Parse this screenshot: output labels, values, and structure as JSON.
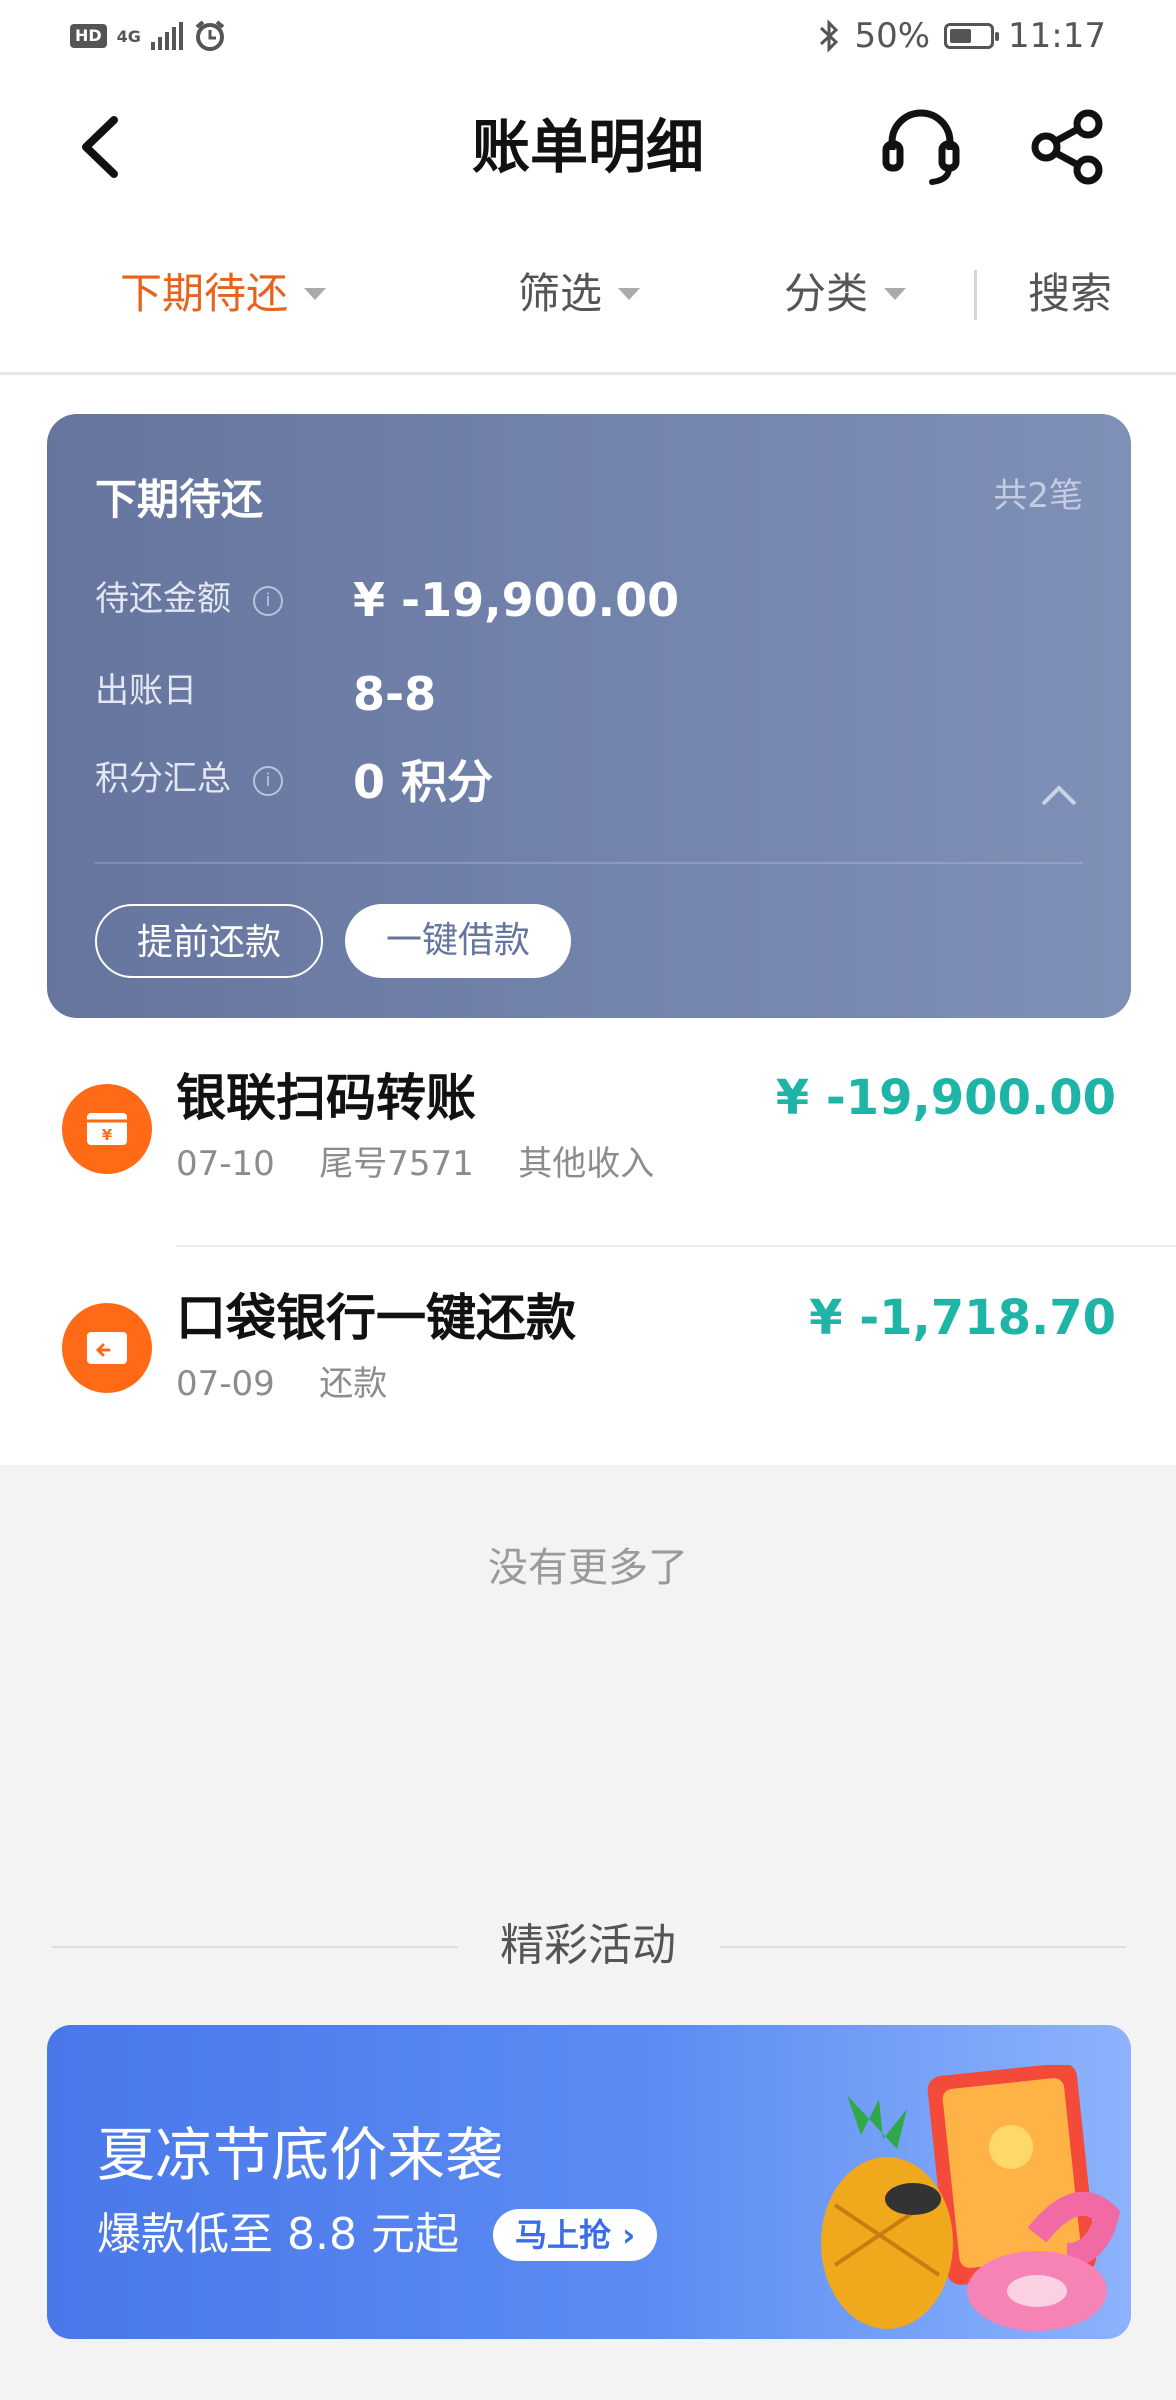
{
  "status_bar": {
    "hd": "HD",
    "network": "4G",
    "battery": "50%",
    "time": "11:17"
  },
  "header": {
    "title": "账单明细"
  },
  "filters": {
    "tab_due": "下期待还",
    "tab_filter": "筛选",
    "tab_category": "分类",
    "search": "搜索"
  },
  "summary": {
    "title": "下期待还",
    "count": "共2笔",
    "amount_label": "待还金额",
    "amount": "¥ -19,900.00",
    "bill_day_label": "出账日",
    "bill_day": "8-8",
    "points_label": "积分汇总",
    "points": "0 积分",
    "prepay_button": "提前还款",
    "borrow_button": "一键借款"
  },
  "transactions": [
    {
      "name": "银联扫码转账",
      "date": "07-10",
      "card": "尾号7571",
      "category": "其他收入",
      "amount": "¥ -19,900.00"
    },
    {
      "name": "口袋银行一键还款",
      "date": "07-09",
      "category": "还款",
      "amount": "¥ -1,718.70"
    }
  ],
  "no_more": "没有更多了",
  "activities": {
    "title": "精彩活动",
    "banner_title": "夏凉节底价来袭",
    "banner_sub": "爆款低至 8.8 元起",
    "banner_button": "马上抢"
  },
  "colors": {
    "accent_orange": "#e8621a",
    "amount_teal": "#1fb5a6",
    "card_bg": "#6b7aa4",
    "banner_bg": "#4f7ff0"
  }
}
